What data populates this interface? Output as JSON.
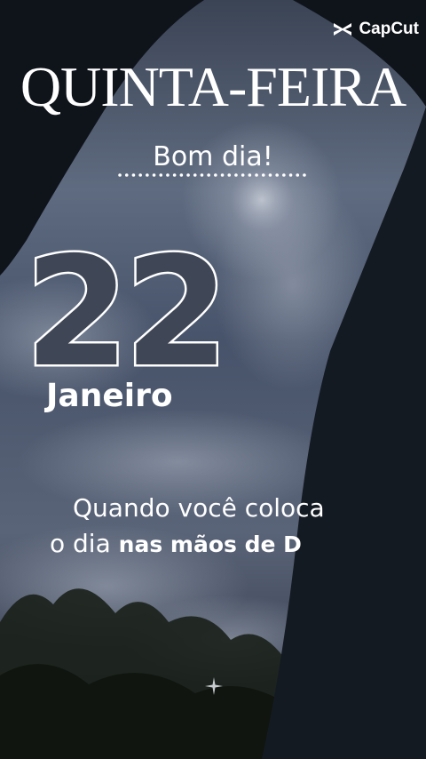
{
  "app": {
    "logo_text": "CapCut",
    "logo_icon": "capcut-logo-icon"
  },
  "card": {
    "weekday": "QUINTA-FEIRA",
    "greeting": "Bom dia!",
    "day_number": "22",
    "month": "Janeiro",
    "message_line1": "Quando você coloca",
    "message_line2_prefix": "o dia ",
    "message_line2_bold": "nas mãos de D"
  },
  "colors": {
    "text": "#ffffff",
    "number_fill": "#3f4656",
    "sky_dark": "#111720",
    "sky_light": "#7e8aa0"
  }
}
